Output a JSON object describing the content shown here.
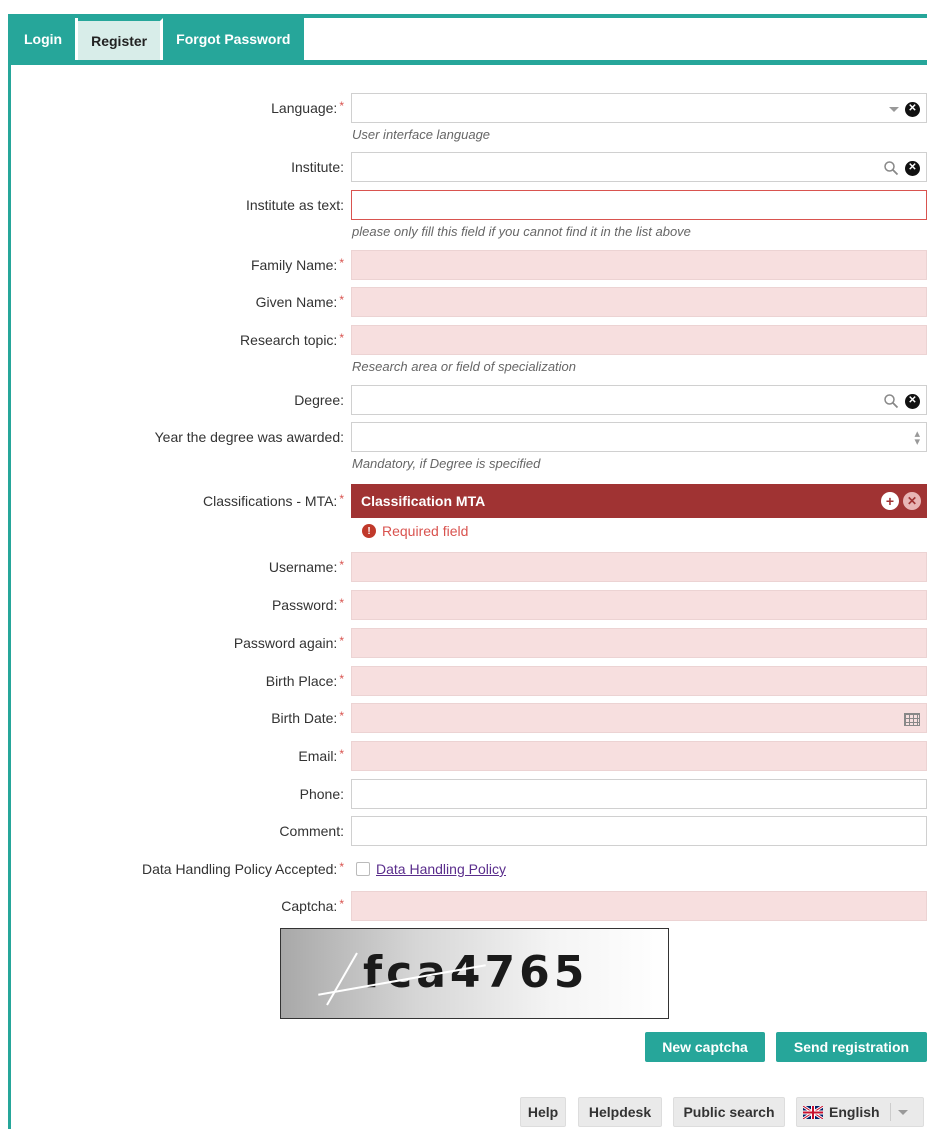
{
  "tabs": [
    {
      "label": "Login"
    },
    {
      "label": "Register"
    },
    {
      "label": "Forgot Password"
    }
  ],
  "active_tab": "Register",
  "form": {
    "language": {
      "label": "Language:",
      "hint": "User interface language"
    },
    "institute": {
      "label": "Institute:"
    },
    "institute_text": {
      "label": "Institute as text:",
      "hint": "please only fill this field if you cannot find it in the list above"
    },
    "family_name": {
      "label": "Family Name:"
    },
    "given_name": {
      "label": "Given Name:"
    },
    "research_topic": {
      "label": "Research topic:",
      "hint": "Research area or field of specialization"
    },
    "degree": {
      "label": "Degree:"
    },
    "degree_year": {
      "label": "Year the degree was awarded:",
      "hint": "Mandatory, if Degree is specified"
    },
    "classifications": {
      "label": "Classifications - MTA:",
      "bar_label": "Classification MTA",
      "error": "Required field"
    },
    "username": {
      "label": "Username:"
    },
    "password": {
      "label": "Password:"
    },
    "password_again": {
      "label": "Password again:"
    },
    "birth_place": {
      "label": "Birth Place:"
    },
    "birth_date": {
      "label": "Birth Date:"
    },
    "email": {
      "label": "Email:"
    },
    "phone": {
      "label": "Phone:"
    },
    "comment": {
      "label": "Comment:"
    },
    "policy": {
      "label": "Data Handling Policy Accepted:",
      "link": "Data Handling Policy",
      "checked": false
    },
    "captcha": {
      "label": "Captcha:",
      "image_text": "fca4765"
    },
    "required_mark": "*"
  },
  "buttons": {
    "new_captcha": "New captcha",
    "send_registration": "Send registration"
  },
  "footer": {
    "help": "Help",
    "helpdesk": "Helpdesk",
    "public_search": "Public search",
    "language": "English"
  },
  "colors": {
    "accent": "#26a69a",
    "required_bg": "#f7dfdf",
    "error": "#d9534f",
    "classification_bar": "#a03333"
  }
}
